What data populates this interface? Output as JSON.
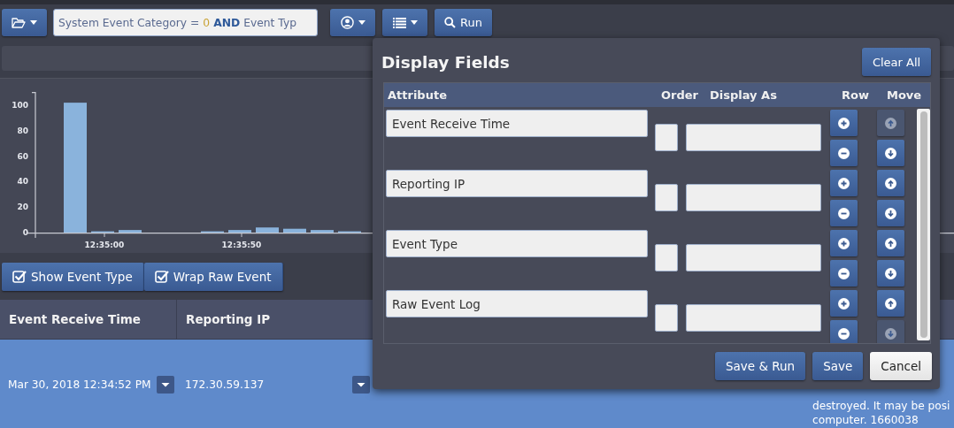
{
  "toolbar": {
    "query": [
      {
        "text": "System Event Category =",
        "kind": "field"
      },
      {
        "text": "0",
        "kind": "value"
      },
      {
        "text": "AND",
        "kind": "operator"
      },
      {
        "text": "Event Typ",
        "kind": "field"
      }
    ],
    "run_button": "Run"
  },
  "chart": {
    "chart_data": {
      "type": "bar",
      "categories": [
        null,
        "12:35:00",
        null,
        null,
        null,
        null,
        "12:35:50",
        null,
        null,
        null,
        null,
        null
      ],
      "values": [
        102,
        1,
        2,
        0,
        0,
        1,
        2,
        4,
        3,
        2,
        1,
        null
      ],
      "ylim": [
        0,
        110
      ],
      "yticks": [
        0,
        20,
        40,
        60,
        80,
        100
      ]
    }
  },
  "options": [
    {
      "label": "Show Event Type",
      "checked": true
    },
    {
      "label": "Wrap Raw Event",
      "checked": true
    }
  ],
  "table": {
    "columns": [
      "Event Receive Time",
      "Reporting IP"
    ],
    "rows": [
      {
        "selected": true,
        "event_receive_time": "Mar 30, 2018 12:34:52 PM",
        "reporting_ip": "172.30.59.137",
        "raw_event_lines": [
          "destroyed. It may be posi",
          "computer. 1660038"
        ]
      }
    ]
  },
  "display_fields": {
    "title": "Display Fields",
    "clear_all": "Clear All",
    "columns": [
      "Attribute",
      "Order",
      "Display As",
      "Row",
      "Move"
    ],
    "fields": [
      {
        "attribute": "Event Receive Time",
        "move_up_disabled": true,
        "move_down_disabled": false
      },
      {
        "attribute": "Reporting IP",
        "move_up_disabled": false,
        "move_down_disabled": false
      },
      {
        "attribute": "Event Type",
        "move_up_disabled": false,
        "move_down_disabled": false
      },
      {
        "attribute": "Raw Event Log",
        "move_up_disabled": false,
        "move_down_disabled": true
      }
    ],
    "buttons": [
      {
        "label": "Save & Run",
        "kind": "primary"
      },
      {
        "label": "Save",
        "kind": "primary"
      },
      {
        "label": "Cancel",
        "kind": "secondary"
      }
    ]
  }
}
